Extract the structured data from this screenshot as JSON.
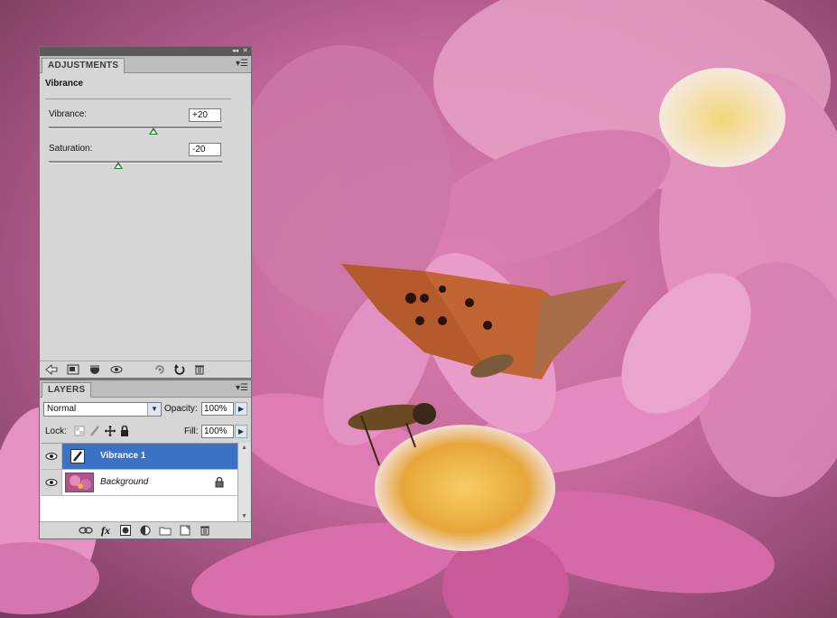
{
  "colors": {
    "panel_bg": "#d6d6d6",
    "selection_blue": "#3a72c6",
    "slider_thumb": "#2d7a2d"
  },
  "adjustments_panel": {
    "tab_label": "ADJUSTMENTS",
    "preset_title": "Vibrance",
    "vibrance": {
      "label": "Vibrance:",
      "value": "+20"
    },
    "saturation": {
      "label": "Saturation:",
      "value": "-20"
    },
    "footer_icons": [
      "back-arrow-icon",
      "clip-to-layer-icon",
      "layer-visibility-icon",
      "eye-icon",
      "view-previous-state-icon",
      "reset-icon",
      "trash-icon"
    ]
  },
  "layers_panel": {
    "tab_label": "LAYERS",
    "blend_mode": "Normal",
    "opacity_label": "Opacity:",
    "opacity_value": "100%",
    "lock_label": "Lock:",
    "fill_label": "Fill:",
    "fill_value": "100%",
    "layers": [
      {
        "name": "Vibrance 1",
        "selected": true,
        "visible": true
      },
      {
        "name": "Background",
        "selected": false,
        "visible": true,
        "locked": true
      }
    ],
    "footer_icons": [
      "link-layers-icon",
      "fx-icon",
      "add-mask-icon",
      "new-adjustment-icon",
      "new-group-icon",
      "new-layer-icon",
      "trash-icon"
    ]
  }
}
